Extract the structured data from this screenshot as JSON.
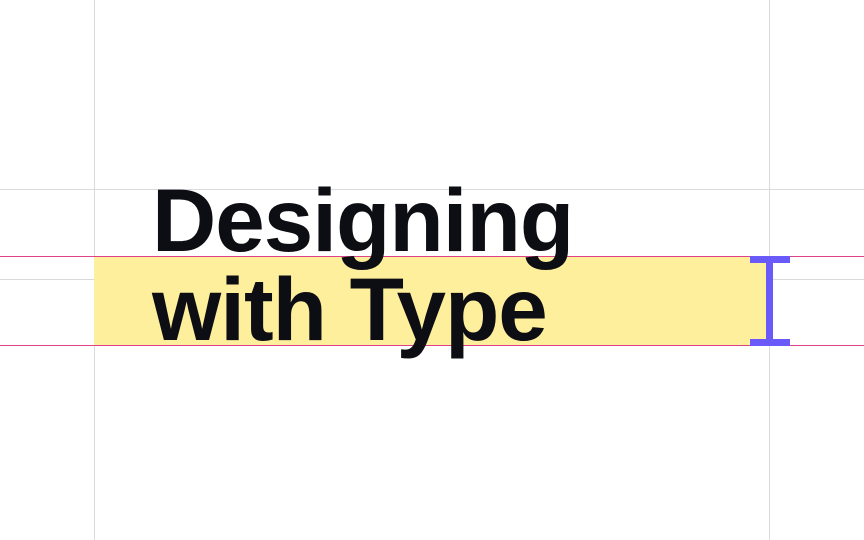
{
  "heading": {
    "line1": "Designing",
    "line2": "with Type"
  },
  "colors": {
    "background": "#ffffff",
    "text": "#0d0d14",
    "grid_guide": "#d9d9de",
    "baseline_guide": "#e0428a",
    "line_height_band": "#fdef9b",
    "measure_handle": "#6a5af9"
  },
  "icons": {
    "measure_handle": "line-height-measure-icon"
  }
}
